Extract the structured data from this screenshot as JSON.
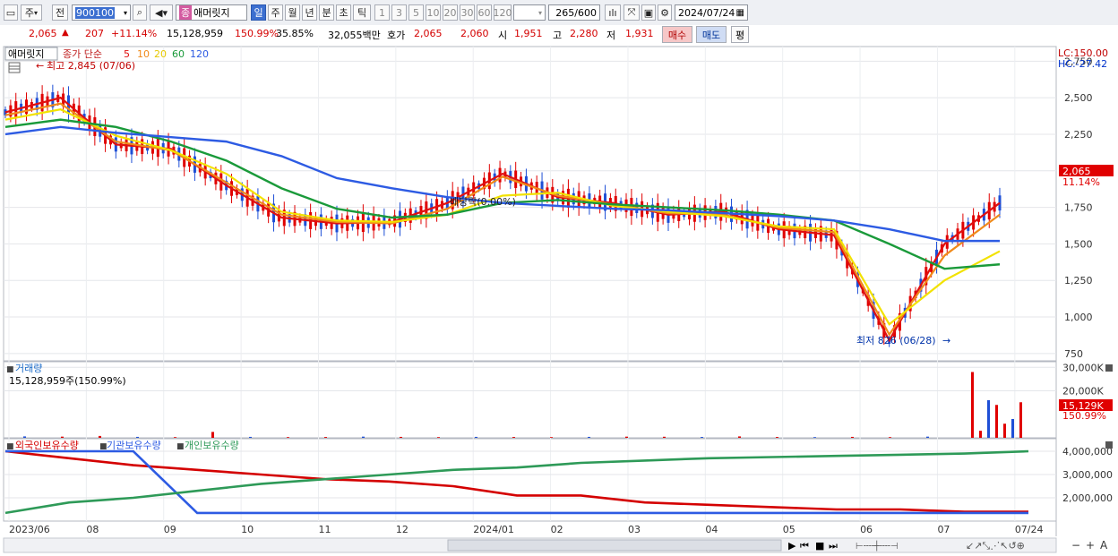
{
  "toolbar": {
    "period_select": "주",
    "prev_label": "전",
    "code": "900100",
    "name": "애머릿지",
    "name_badge": "종",
    "periods": [
      "일",
      "주",
      "월",
      "년",
      "분",
      "초",
      "틱"
    ],
    "active_period": "일",
    "minutes": [
      "1",
      "3",
      "5",
      "10",
      "20",
      "30",
      "60",
      "120"
    ],
    "count": "265",
    "count_total": "/600",
    "date": "2024/07/24"
  },
  "quote": {
    "price": "2,065",
    "arrow": "▲",
    "change": "207",
    "change_pct": "+11.14%",
    "volume": "15,128,959",
    "volume_ratio": "150.99%",
    "turnover": "35.85%",
    "amount": "32,055백만",
    "bid_label": "호가",
    "ask_price": "2,065",
    "bid_price": "2,060",
    "open_label": "시",
    "open": "1,951",
    "high_label": "고",
    "high": "2,280",
    "low_label": "저",
    "low": "1,931",
    "buy_label": "매수",
    "sell_label": "매도",
    "eval_label": "평"
  },
  "price_panel": {
    "name_tag": "애머릿지",
    "ma_label": "종가 단순",
    "ma_periods": [
      "5",
      "10",
      "20",
      "60",
      "120"
    ],
    "ma_colors": [
      "#e01010",
      "#f08a1a",
      "#f2e200",
      "#1a9a3a",
      "#2d5be3"
    ],
    "high_note": "최고 2,845 (07/06)",
    "low_note": "최저 826 (06/28)",
    "dividend_note": "배당락(0.00%)",
    "lc": "LC:150.00",
    "hc": "HC:-27.42",
    "price_tag": "2,065",
    "pct_tag": "11.14%"
  },
  "volume_panel": {
    "title": "거래량",
    "value_text": "15,128,959주(150.99%)",
    "tag_value": "15,129K",
    "tag_pct": "150.99%"
  },
  "holdings_panel": {
    "legend": [
      "외국인보유수량",
      "기관보유수량",
      "개인보유수량"
    ],
    "colors": [
      "#d40000",
      "#2d5be3",
      "#2e9a58"
    ]
  },
  "chart_data": [
    {
      "type": "line",
      "title": "애머릿지",
      "x": [
        "2023/06",
        "08",
        "09",
        "10",
        "11",
        "12",
        "2024/01",
        "02",
        "03",
        "04",
        "05",
        "06",
        "07",
        "07/24"
      ],
      "ylim": [
        700,
        2850
      ],
      "yticks": [
        750,
        1000,
        1250,
        1500,
        1750,
        2000,
        2250,
        2500,
        2750
      ],
      "series": [
        {
          "name": "5",
          "values": [
            2400,
            2500,
            2180,
            2150,
            1900,
            1680,
            1640,
            1650,
            1780,
            1980,
            1820,
            1780,
            1700,
            1720,
            1600,
            1560,
            840,
            1500,
            1780
          ]
        },
        {
          "name": "10",
          "values": [
            2380,
            2460,
            2200,
            2140,
            1920,
            1700,
            1650,
            1640,
            1740,
            1960,
            1830,
            1770,
            1710,
            1700,
            1610,
            1580,
            880,
            1420,
            1700
          ]
        },
        {
          "name": "20",
          "values": [
            2350,
            2420,
            2240,
            2140,
            1980,
            1720,
            1660,
            1650,
            1700,
            1830,
            1850,
            1760,
            1720,
            1690,
            1620,
            1600,
            950,
            1250,
            1450
          ]
        },
        {
          "name": "60",
          "values": [
            2300,
            2350,
            2300,
            2200,
            2070,
            1880,
            1740,
            1680,
            1700,
            1780,
            1800,
            1770,
            1750,
            1730,
            1700,
            1660,
            1500,
            1330,
            1360
          ]
        },
        {
          "name": "120",
          "values": [
            2250,
            2300,
            2260,
            2230,
            2200,
            2100,
            1950,
            1880,
            1820,
            1780,
            1760,
            1740,
            1730,
            1710,
            1690,
            1660,
            1600,
            1520,
            1520
          ]
        }
      ]
    },
    {
      "type": "bar",
      "title": "거래량",
      "ylim": [
        0,
        32000
      ],
      "yticks": [
        20000,
        30000
      ],
      "values": [
        600,
        500,
        800,
        400,
        300,
        2500,
        400,
        300,
        350,
        500,
        400,
        300,
        400,
        350,
        300,
        400,
        500,
        450,
        350,
        600,
        350,
        300,
        400,
        300,
        500,
        28000,
        3000,
        16000,
        14000,
        6000,
        8000,
        15129
      ]
    },
    {
      "type": "line",
      "ylim": [
        1000000,
        4500000
      ],
      "yticks": [
        2000000,
        3000000,
        4000000
      ],
      "series": [
        {
          "name": "외국인보유수량",
          "values": [
            4000000,
            3700000,
            3400000,
            3200000,
            3000000,
            2800000,
            2700000,
            2500000,
            2100000,
            2100000,
            1800000,
            1700000,
            1600000,
            1500000,
            1500000,
            1400000,
            1400000
          ]
        },
        {
          "name": "기관보유수량",
          "values": [
            4000000,
            4000000,
            4000000,
            1350000,
            1350000,
            1350000,
            1350000,
            1350000,
            1350000,
            1350000,
            1350000,
            1350000,
            1350000,
            1350000,
            1350000,
            1350000,
            1350000
          ]
        },
        {
          "name": "개인보유수량",
          "values": [
            1350000,
            1800000,
            2000000,
            2300000,
            2600000,
            2800000,
            3000000,
            3200000,
            3300000,
            3500000,
            3600000,
            3700000,
            3750000,
            3800000,
            3850000,
            3900000,
            4000000
          ]
        }
      ]
    }
  ]
}
